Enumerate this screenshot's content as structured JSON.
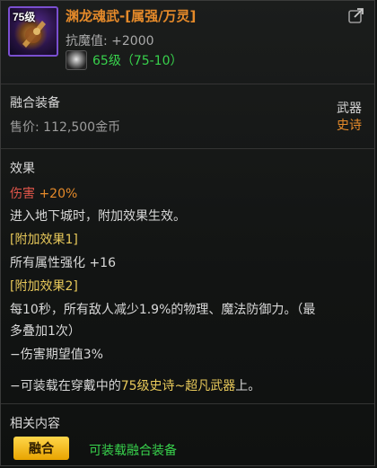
{
  "item": {
    "icon_level": "75级",
    "name": "渊龙魂武-[属强/万灵]",
    "resist_label": "抗魔值:",
    "resist_value": "+2000",
    "level_text": "65级（75-10）",
    "icons": {
      "item": "weapon-item-icon",
      "share": "share-icon",
      "gem": "gem-icon"
    }
  },
  "info": {
    "title": "融合装备",
    "price_label": "售价:",
    "price_value": "112,500金币",
    "type": "武器",
    "rarity": "史诗"
  },
  "effects": {
    "title": "效果",
    "damage_label": "伤害",
    "damage_value": "+20%",
    "line1": "进入地下城时，附加效果生效。",
    "extra1_label": "[附加效果1]",
    "extra1_text": "所有属性强化 +16",
    "extra2_label": "[附加效果2]",
    "extra2_line1": "每10秒，所有敌人减少1.9%的物理、魔法防御力。（最",
    "extra2_line2": "多叠加1次）",
    "extra2_line3": "−伤害期望值3%",
    "equip_prefix": "−可装载在穿戴中的",
    "equip_highlight": "75级史诗~超凡武器",
    "equip_suffix": "上。"
  },
  "related": {
    "title": "相关内容",
    "button_label": "融合",
    "note": "可装载融合装备"
  },
  "colors": {
    "name": "#e58a2a",
    "green": "#38d24c",
    "yellow": "#e8c95a",
    "button": "#f3bd1a"
  }
}
